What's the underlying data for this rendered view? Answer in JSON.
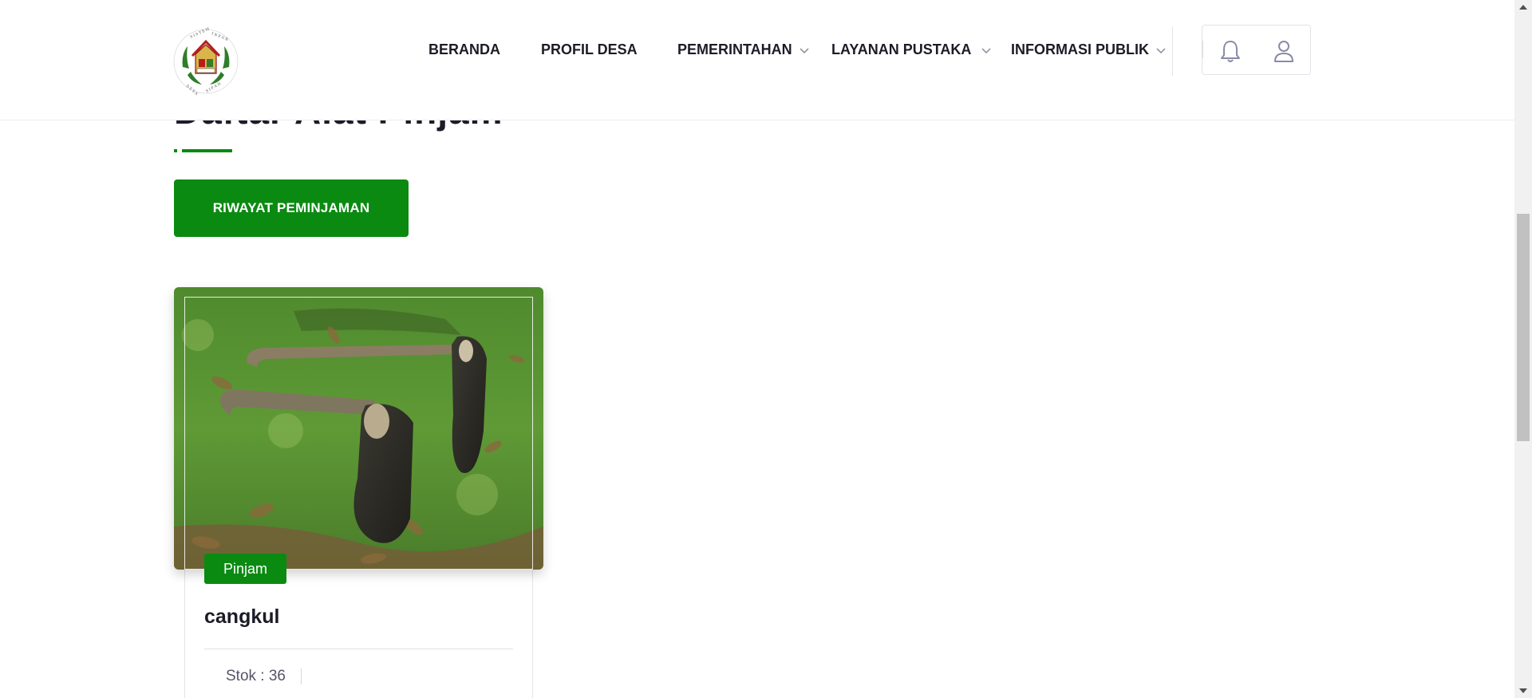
{
  "header": {
    "nav": [
      {
        "label": "BERANDA",
        "has_dropdown": false
      },
      {
        "label": "PROFIL DESA",
        "has_dropdown": false
      },
      {
        "label": "PEMERINTAHAN",
        "has_dropdown": true
      },
      {
        "label": "LAYANAN PUSTAKA",
        "has_dropdown": true
      },
      {
        "label": "INFORMASI PUBLIK",
        "has_dropdown": true
      }
    ],
    "icons": [
      "bell-icon",
      "user-icon"
    ],
    "logo": {
      "ring_text": "SISTEM INFORMASI DESA SIPAHUTAR"
    }
  },
  "main": {
    "section_title": "Daftar Alat Pinjam",
    "history_button": "RIWAYAT PEMINJAMAN",
    "products": [
      {
        "name": "cangkul",
        "borrow_label": "Pinjam",
        "stock_label": "Stok : 36",
        "image_icon": "hoe-tools-photo"
      }
    ]
  },
  "colors": {
    "accent_green": "#0b8a12",
    "text_dark": "#1c1c28",
    "header_bg": "#ffffff"
  }
}
